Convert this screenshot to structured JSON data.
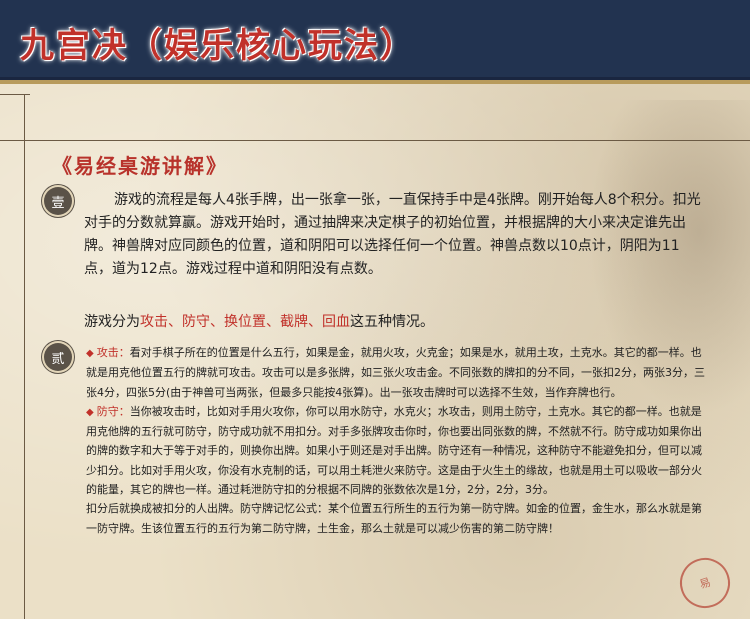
{
  "header": {
    "title": "九宫决（娱乐核心玩法）"
  },
  "section": {
    "title": "《易经桌游讲解》"
  },
  "badges": {
    "one": "壹",
    "two": "贰"
  },
  "intro": {
    "paragraph": "游戏的流程是每人4张手牌，出一张拿一张，一直保持手中是4张牌。刚开始每人8个积分。扣光对手的分数就算赢。游戏开始时，通过抽牌来决定棋子的初始位置，并根据牌的大小来决定谁先出牌。神兽牌对应同颜色的位置，道和阴阳可以选择任何一个位置。神兽点数以10点计，阴阳为11点，道为12点。游戏过程中道和阴阳没有点数。",
    "situations_prefix": "游戏分为",
    "situations": "攻击、防守、换位置、截牌、回血",
    "situations_suffix": "这五种情况。"
  },
  "list": {
    "attack_term": "攻击：",
    "attack_text": "看对手棋子所在的位置是什么五行，如果是金，就用火攻，火克金；如果是水，就用土攻，土克水。其它的都一样。也就是用克他位置五行的牌就可攻击。攻击可以是多张牌，如三张火攻击金。不同张数的牌扣的分不同，一张扣2分，两张3分，三张4分，四张5分(由于神兽可当两张，但最多只能按4张算)。出一张攻击牌时可以选择不生效，当作弃牌也行。",
    "defense_term": "防守：",
    "defense_text": "当你被攻击时，比如对手用火攻你，你可以用水防守，水克火；水攻击，则用土防守，土克水。其它的都一样。也就是用克他牌的五行就可防守，防守成功就不用扣分。对手多张牌攻击你时，你也要出同张数的牌，不然就不行。防守成功如果你出的牌的数字和大于等于对手的，则换你出牌。如果小于则还是对手出牌。防守还有一种情况，这种防守不能避免扣分，但可以减少扣分。比如对手用火攻，你没有水克制的话，可以用土耗泄火来防守。这是由于火生土的缘故，也就是用土可以吸收一部分火的能量，其它的牌也一样。通过耗泄防守扣的分根据不同牌的张数依次是1分，2分，2分，3分。",
    "defense_extra": "扣分后就换成被扣分的人出牌。防守牌记忆公式：某个位置五行所生的五行为第一防守牌。如金的位置，金生水，那么水就是第一防守牌。生该位置五行的五行为第二防守牌，土生金，那么土就是可以减少伤害的第二防守牌！"
  },
  "seal": {
    "text": "易"
  }
}
